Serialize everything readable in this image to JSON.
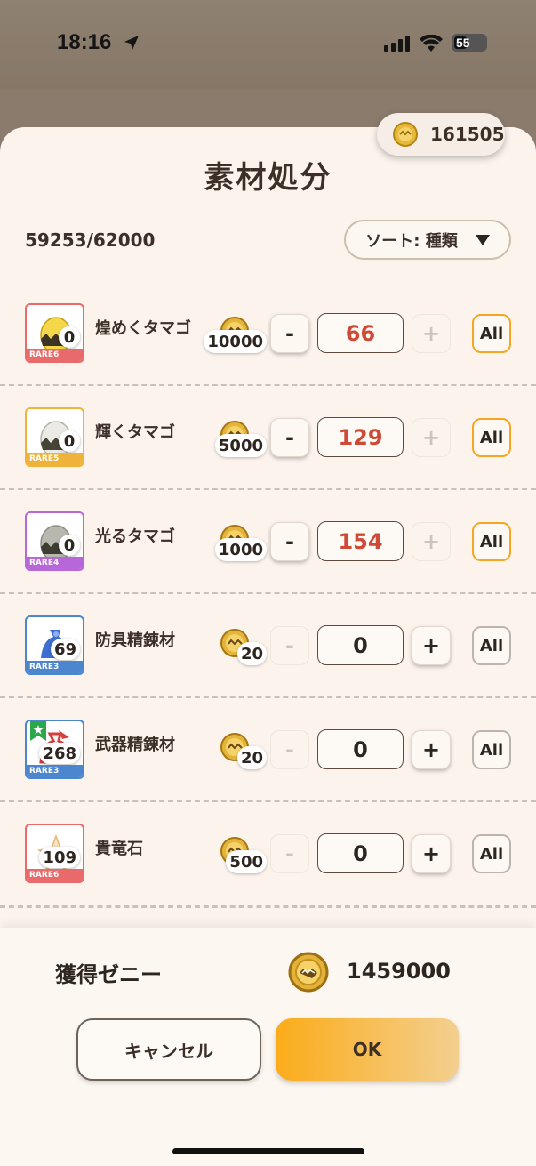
{
  "status": {
    "time": "18:16",
    "battery": "55"
  },
  "wallet": {
    "coins": "161505"
  },
  "title": "素材処分",
  "capacity": "59253/62000",
  "sort": {
    "label": "ソート: 種類"
  },
  "items": [
    {
      "name": "煌めくタマゴ",
      "rarity": "RARE6",
      "owned": "0",
      "price": "10000",
      "quantity": "66",
      "minus_enabled": true,
      "plus_enabled": false,
      "all_enabled": true,
      "color": "#e86a6a",
      "art": "egg-gold"
    },
    {
      "name": "輝くタマゴ",
      "rarity": "RARE5",
      "owned": "0",
      "price": "5000",
      "quantity": "129",
      "minus_enabled": true,
      "plus_enabled": false,
      "all_enabled": true,
      "color": "#f0b33a",
      "art": "egg-silver"
    },
    {
      "name": "光るタマゴ",
      "rarity": "RARE4",
      "owned": "0",
      "price": "1000",
      "quantity": "154",
      "minus_enabled": true,
      "plus_enabled": false,
      "all_enabled": true,
      "color": "#b867d8",
      "art": "egg-gray"
    },
    {
      "name": "防具精錬材",
      "rarity": "RARE3",
      "owned": "69",
      "price": "20",
      "quantity": "0",
      "minus_enabled": false,
      "plus_enabled": true,
      "all_enabled": false,
      "color": "#4b86cf",
      "art": "bag-blue"
    },
    {
      "name": "武器精錬材",
      "rarity": "RARE3",
      "owned": "268",
      "price": "20",
      "quantity": "0",
      "minus_enabled": false,
      "plus_enabled": true,
      "all_enabled": false,
      "color": "#4b86cf",
      "art": "bag-red"
    },
    {
      "name": "貴竜石",
      "rarity": "RARE6",
      "owned": "109",
      "price": "500",
      "quantity": "0",
      "minus_enabled": false,
      "plus_enabled": true,
      "all_enabled": false,
      "color": "#e86a6a",
      "art": "stone-star"
    }
  ],
  "controls": {
    "minus": "-",
    "plus": "+",
    "all": "All"
  },
  "footer": {
    "earn_label": "獲得ゼニー",
    "earn_value": "1459000",
    "cancel": "キャンセル",
    "ok": "OK"
  },
  "colors": {
    "accent": "#f5a623",
    "qty_red": "#cf4a36",
    "sheet_bg": "#fbf3ec"
  }
}
